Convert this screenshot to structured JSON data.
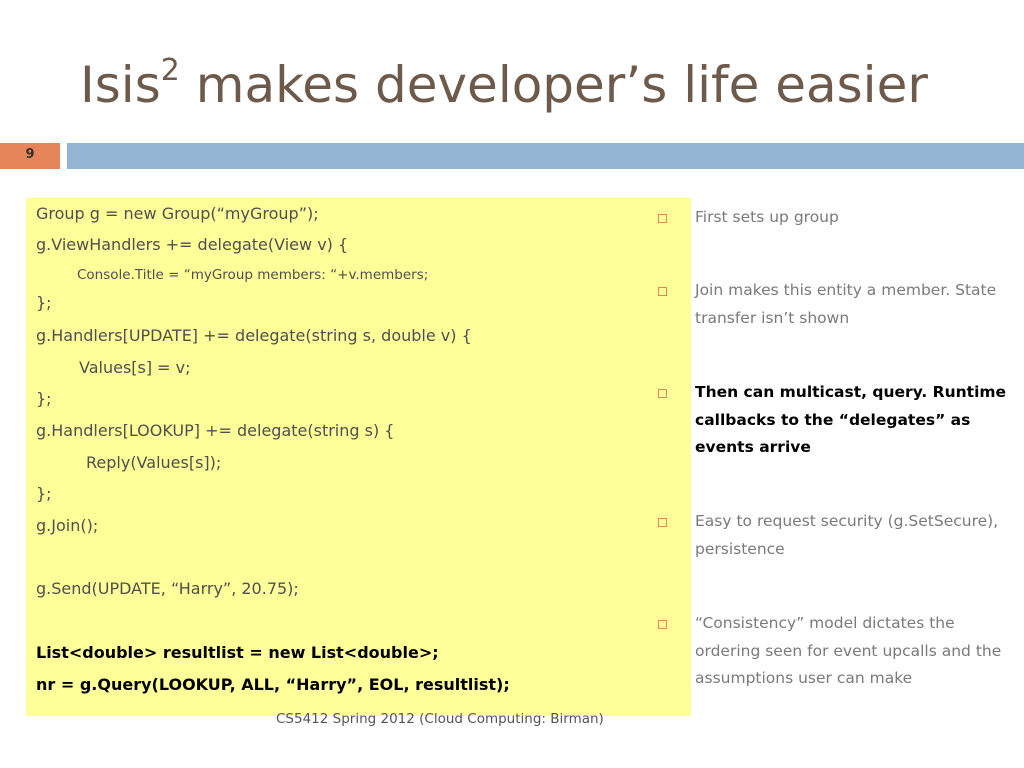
{
  "slide": {
    "title_main": "Isis",
    "title_sup": "2",
    "title_rest": " makes developer’s life easier",
    "number": "9",
    "footer": "CS5412 Spring 2012 (Cloud Computing: Birman)"
  },
  "code": {
    "lines": [
      "Group g = new Group(“myGroup”);",
      "g.ViewHandlers += delegate(View v) {",
      "Console.Title = “myGroup members: “+v.members;",
      "};",
      "g.Handlers[UPDATE] += delegate(string s, double v) {",
      "Values[s] = v;",
      "};",
      "g.Handlers[LOOKUP] += delegate(string s) {",
      "Reply(Values[s]);",
      "};",
      "g.Join();",
      "g.Send(UPDATE, “Harry”, 20.75);",
      "List<double> resultlist = new List<double>;",
      "nr = g.Query(LOOKUP, ALL, “Harry”, EOL, resultlist);"
    ]
  },
  "bullets": [
    "First sets up group",
    "Join makes this entity a member. State transfer isn’t shown",
    "Then can multicast, query. Runtime callbacks to the “delegates” as events arrive",
    "Easy to request security (g.SetSecure), persistence",
    "“Consistency” model dictates the ordering seen for event upcalls and the assumptions user can make"
  ],
  "colors": {
    "title": "#6d5a4b",
    "accent_orange": "#e6855a",
    "accent_blue": "#94b6d2",
    "code_background": "#ffff99"
  }
}
